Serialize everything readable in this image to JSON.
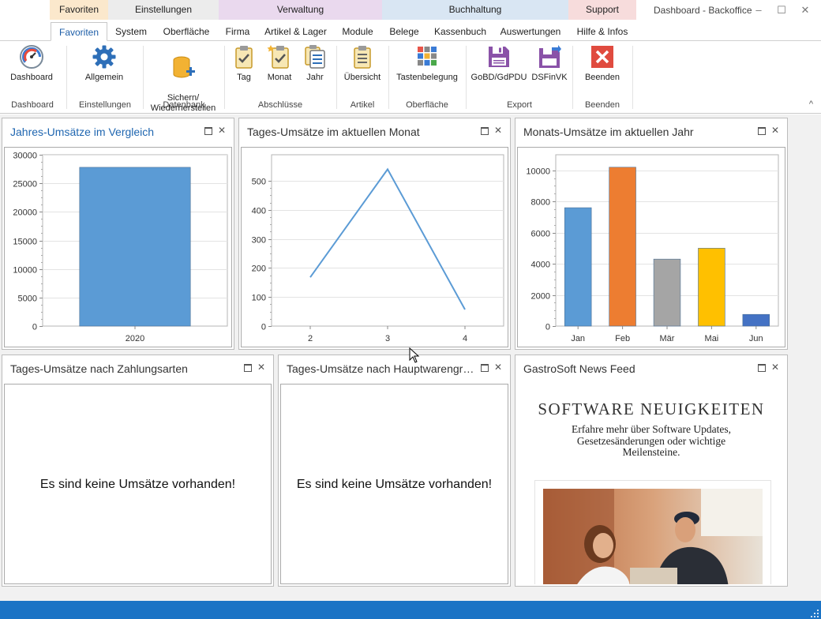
{
  "window": {
    "title": "Dashboard - Backoffice",
    "minimize": "–",
    "maximize": "☐",
    "close": "✕"
  },
  "categories": [
    {
      "label": "Favoriten",
      "color": "#fbe8cc"
    },
    {
      "label": "Einstellungen",
      "color": "#ececec"
    },
    {
      "label": "Verwaltung",
      "color": "#ead9ee"
    },
    {
      "label": "Buchhaltung",
      "color": "#d9e6f3"
    },
    {
      "label": "Support",
      "color": "#f7dcdc"
    }
  ],
  "tabs": [
    {
      "label": "Favoriten"
    },
    {
      "label": "System"
    },
    {
      "label": "Oberfläche"
    },
    {
      "label": "Firma"
    },
    {
      "label": "Artikel & Lager"
    },
    {
      "label": "Module"
    },
    {
      "label": "Belege"
    },
    {
      "label": "Kassenbuch"
    },
    {
      "label": "Auswertungen"
    },
    {
      "label": "Hilfe & Infos"
    }
  ],
  "ribbon": {
    "buttons": [
      {
        "label": "Dashboard",
        "icon": "gauge-icon"
      },
      {
        "label": "Allgemein",
        "icon": "gear-icon"
      },
      {
        "label": "Sichern/\nWiederherstellen",
        "icon": "database-icon"
      },
      {
        "label": "Tag",
        "icon": "clipboard-check-icon"
      },
      {
        "label": "Monat",
        "icon": "clipboard-star-icon"
      },
      {
        "label": "Jahr",
        "icon": "clipboard-stack-icon"
      },
      {
        "label": "Übersicht",
        "icon": "clipboard-list-icon"
      },
      {
        "label": "Tastenbelegung",
        "icon": "tiles-icon"
      },
      {
        "label": "GoBD/GdPDU",
        "icon": "save-icon"
      },
      {
        "label": "DSFinVK",
        "icon": "save-export-icon"
      },
      {
        "label": "Beenden",
        "icon": "exit-icon"
      }
    ],
    "groups": [
      {
        "label": "Dashboard"
      },
      {
        "label": "Einstellungen"
      },
      {
        "label": "Datenbank"
      },
      {
        "label": "Abschlüsse"
      },
      {
        "label": "Artikel"
      },
      {
        "label": "Oberfläche"
      },
      {
        "label": "Export"
      },
      {
        "label": "Beenden"
      }
    ],
    "collapse": "^"
  },
  "panels": {
    "jahres": {
      "title": "Jahres-Umsätze im Vergleich"
    },
    "tages_monat": {
      "title": "Tages-Umsätze im aktuellen Monat"
    },
    "monats": {
      "title": "Monats-Umsätze im aktuellen Jahr"
    },
    "zahlungsarten": {
      "title": "Tages-Umsätze nach Zahlungsarten",
      "message": "Es sind keine Umsätze vorhanden!"
    },
    "warengruppen": {
      "title": "Tages-Umsätze nach Hauptwarengru...",
      "message": "Es sind keine Umsätze vorhanden!"
    },
    "news": {
      "title": "GastroSoft News Feed",
      "headline": "SOFTWARE NEUIGKEITEN",
      "subline": "Erfahre mehr über Software Updates, Gesetzesänderungen oder wichtige Meilensteine."
    }
  },
  "chart_data": [
    {
      "type": "bar",
      "categories": [
        "2020"
      ],
      "values": [
        27800
      ],
      "ylim": [
        0,
        30000
      ],
      "yticks": [
        0,
        5000,
        10000,
        15000,
        20000,
        25000,
        30000
      ],
      "colors": [
        "#5b9bd5"
      ],
      "grid": true
    },
    {
      "type": "line",
      "x": [
        2,
        3,
        4
      ],
      "values": [
        168,
        540,
        57
      ],
      "ylim": [
        0,
        590
      ],
      "yticks": [
        0,
        100,
        200,
        300,
        400,
        500
      ],
      "colors": [
        "#5b9bd5"
      ],
      "grid": true
    },
    {
      "type": "bar",
      "categories": [
        "Jan",
        "Feb",
        "Mär",
        "Mai",
        "Jun"
      ],
      "values": [
        7600,
        10200,
        4300,
        5000,
        750
      ],
      "ylim": [
        0,
        11000
      ],
      "yticks": [
        0,
        2000,
        4000,
        6000,
        8000,
        10000
      ],
      "colors": [
        "#5b9bd5",
        "#ed7d31",
        "#a5a5a5",
        "#ffc000",
        "#4472c4"
      ],
      "grid": true
    }
  ]
}
